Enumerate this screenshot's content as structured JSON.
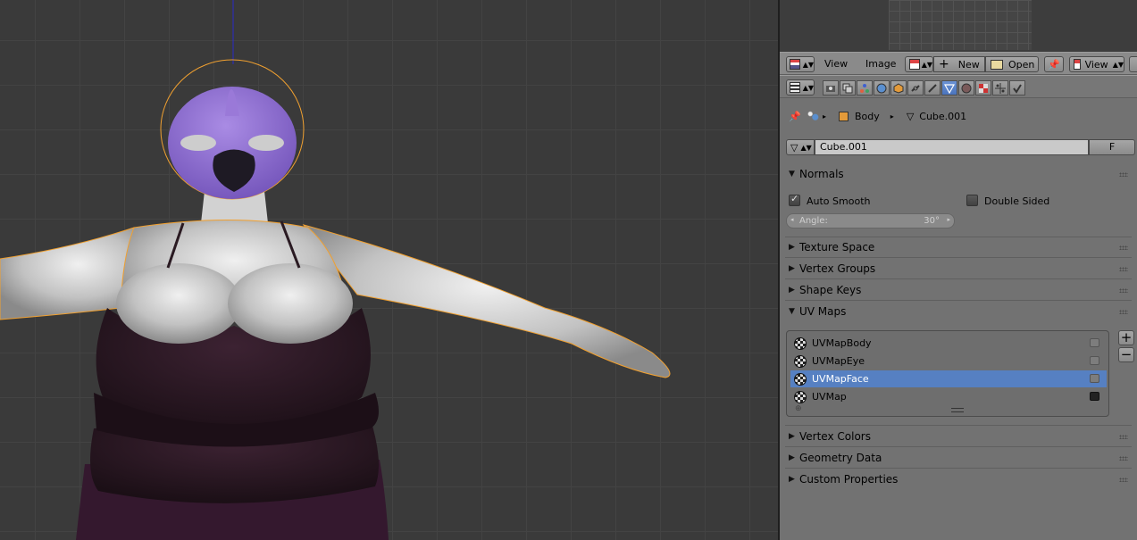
{
  "image_header": {
    "menu_view": "View",
    "menu_image": "Image",
    "new_label": "New",
    "open_label": "Open",
    "view_mode": "View"
  },
  "breadcrumb": {
    "object": "Body",
    "mesh": "Cube.001"
  },
  "datablock": {
    "name": "Cube.001",
    "fake_user": "F"
  },
  "normals": {
    "title": "Normals",
    "auto_smooth_label": "Auto Smooth",
    "auto_smooth": true,
    "double_sided_label": "Double Sided",
    "double_sided": false,
    "angle_label": "Angle:",
    "angle_value": "30°"
  },
  "sections": {
    "texture_space": "Texture Space",
    "vertex_groups": "Vertex Groups",
    "shape_keys": "Shape Keys",
    "uv_maps": "UV Maps",
    "vertex_colors": "Vertex Colors",
    "geometry_data": "Geometry Data",
    "custom_properties": "Custom Properties"
  },
  "uv_maps": [
    {
      "name": "UVMapBody",
      "selected": false,
      "render": false
    },
    {
      "name": "UVMapEye",
      "selected": false,
      "render": false
    },
    {
      "name": "UVMapFace",
      "selected": true,
      "render": false
    },
    {
      "name": "UVMap",
      "selected": false,
      "render": true
    }
  ],
  "colors": {
    "selected_row": "#5680c2",
    "selection_outline": "#f0a030",
    "head": "#9a79d8",
    "body": "#c8c8c8",
    "clothing": "#2c1824"
  }
}
